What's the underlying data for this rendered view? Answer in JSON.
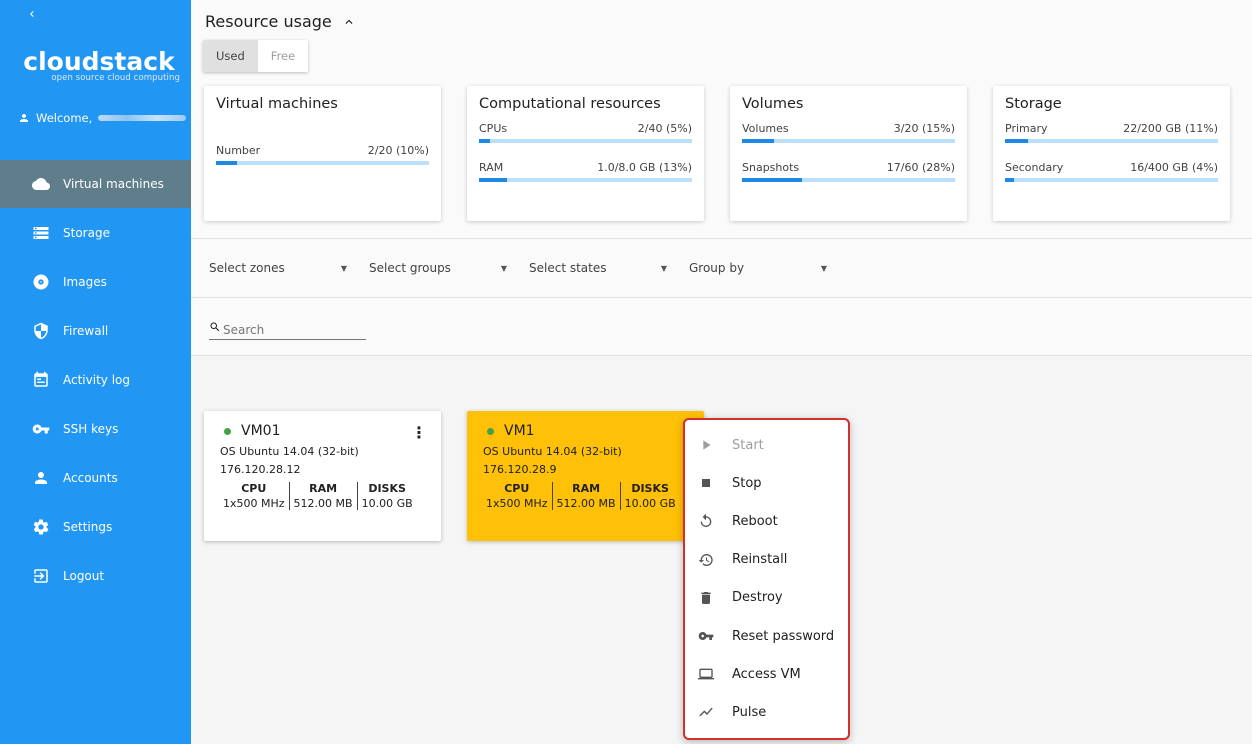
{
  "sidebar": {
    "collapse_icon": "chevron-left-icon",
    "logo": {
      "brand": "cloudstack",
      "tagline": "open source cloud computing"
    },
    "welcome": "Welcome,",
    "items": [
      {
        "label": "Virtual machines",
        "icon": "cloud-icon",
        "active": true
      },
      {
        "label": "Storage",
        "icon": "storage-icon"
      },
      {
        "label": "Images",
        "icon": "disc-icon"
      },
      {
        "label": "Firewall",
        "icon": "shield-icon"
      },
      {
        "label": "Activity log",
        "icon": "calendar-icon"
      },
      {
        "label": "SSH keys",
        "icon": "key-icon"
      },
      {
        "label": "Accounts",
        "icon": "person-icon"
      },
      {
        "label": "Settings",
        "icon": "gear-icon"
      },
      {
        "label": "Logout",
        "icon": "logout-icon"
      }
    ]
  },
  "resources": {
    "title": "Resource usage",
    "toggle": {
      "used": "Used",
      "free": "Free"
    },
    "cards": [
      {
        "title": "Virtual machines",
        "metrics": [
          {
            "label": "Number",
            "value": "2/20 (10%)",
            "fraction": 0.1
          }
        ]
      },
      {
        "title": "Computational resources",
        "metrics": [
          {
            "label": "CPUs",
            "value": "2/40 (5%)",
            "fraction": 0.05
          },
          {
            "label": "RAM",
            "value": "1.0/8.0 GB (13%)",
            "fraction": 0.13
          }
        ]
      },
      {
        "title": "Volumes",
        "metrics": [
          {
            "label": "Volumes",
            "value": "3/20 (15%)",
            "fraction": 0.15
          },
          {
            "label": "Snapshots",
            "value": "17/60 (28%)",
            "fraction": 0.28
          }
        ]
      },
      {
        "title": "Storage",
        "metrics": [
          {
            "label": "Primary",
            "value": "22/200 GB (11%)",
            "fraction": 0.11
          },
          {
            "label": "Secondary",
            "value": "16/400 GB (4%)",
            "fraction": 0.04
          }
        ]
      }
    ]
  },
  "filters": {
    "zones": "Select zones",
    "groups": "Select groups",
    "states": "Select states",
    "group_by": "Group by"
  },
  "search": {
    "placeholder": "Search"
  },
  "vms": [
    {
      "name": "VM01",
      "os": "OS Ubuntu 14.04 (32-bit)",
      "ip": "176.120.28.12",
      "cpu_label": "CPU",
      "cpu": "1x500 MHz",
      "ram_label": "RAM",
      "ram": "512.00 MB",
      "disks_label": "DISKS",
      "disks": "10.00 GB"
    },
    {
      "name": "VM1",
      "os": "OS Ubuntu 14.04 (32-bit)",
      "ip": "176.120.28.9",
      "cpu_label": "CPU",
      "cpu": "1x500 MHz",
      "ram_label": "RAM",
      "ram": "512.00 MB",
      "disks_label": "DISKS",
      "disks": "10.00 GB"
    }
  ],
  "context_menu": {
    "items": [
      {
        "label": "Start",
        "icon": "play-icon",
        "disabled": true
      },
      {
        "label": "Stop",
        "icon": "stop-icon"
      },
      {
        "label": "Reboot",
        "icon": "reboot-icon"
      },
      {
        "label": "Reinstall",
        "icon": "reinstall-icon"
      },
      {
        "label": "Destroy",
        "icon": "trash-icon"
      },
      {
        "label": "Reset password",
        "icon": "key-icon"
      },
      {
        "label": "Access VM",
        "icon": "laptop-icon"
      },
      {
        "label": "Pulse",
        "icon": "pulse-icon"
      }
    ]
  },
  "colors": {
    "sidebar": "#2196f3",
    "active_nav": "#607d8b",
    "selected_vm": "#ffc107",
    "menu_border": "#d32f2f",
    "status_running": "#43a047"
  }
}
